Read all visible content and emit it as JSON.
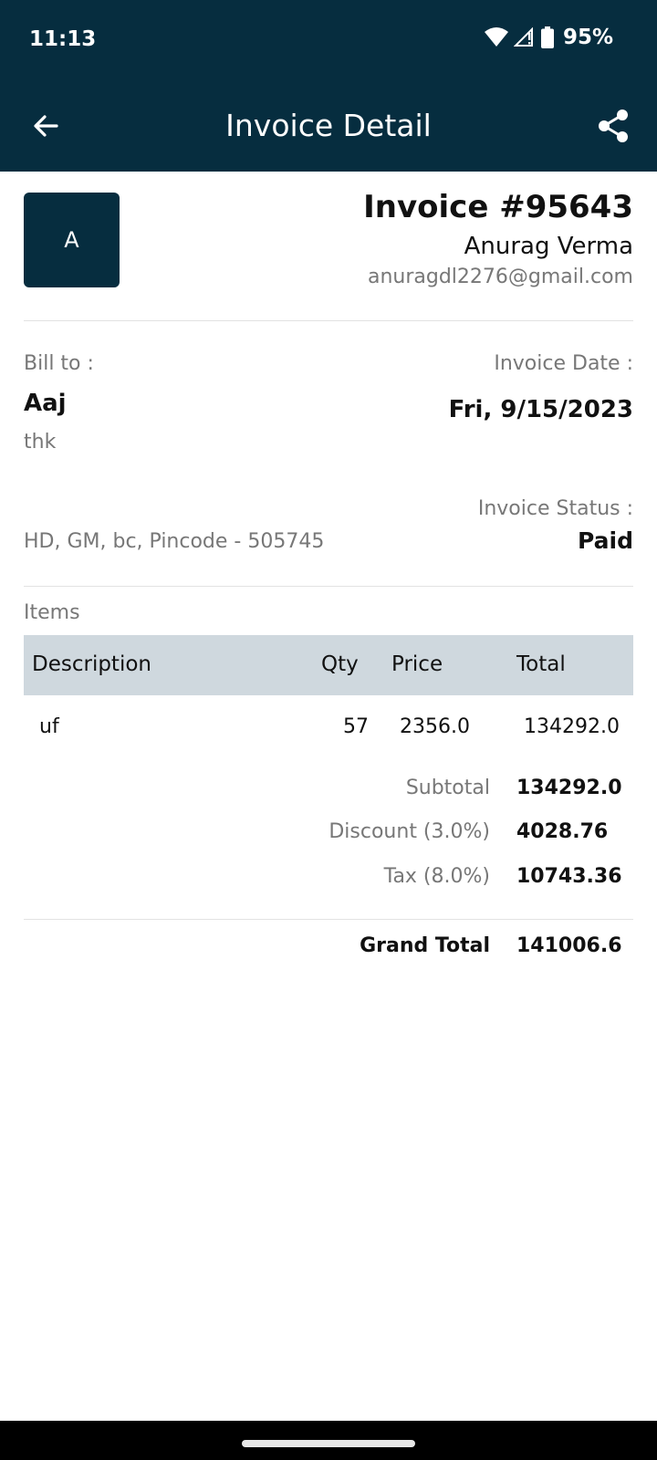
{
  "status_bar": {
    "time": "11:13",
    "battery": "95%",
    "icons": [
      "wifi-icon",
      "signal-icon",
      "battery-icon"
    ]
  },
  "app_bar": {
    "title": "Invoice Detail",
    "back_icon": "arrow-back-icon",
    "share_icon": "share-icon"
  },
  "header": {
    "avatar_initial": "A",
    "invoice_number": "Invoice #95643",
    "sender_name": "Anurag Verma",
    "sender_email": "anuragdl2276@gmail.com"
  },
  "bill_to": {
    "label": "Bill to :",
    "name": "Aaj",
    "subline": "thk",
    "address": "HD, GM, bc, Pincode - 505745"
  },
  "invoice_meta": {
    "date_label": "Invoice Date :",
    "date_value": "Fri, 9/15/2023",
    "status_label": "Invoice Status :",
    "status_value": "Paid"
  },
  "items": {
    "label": "Items",
    "columns": [
      "Description",
      "Qty",
      "Price",
      "Total"
    ],
    "rows": [
      {
        "description": "uf",
        "qty": "57",
        "price": "2356.0",
        "total": "134292.0"
      }
    ]
  },
  "summary": {
    "subtotal_label": "Subtotal",
    "subtotal_value": "134292.0",
    "discount_label": "Discount (3.0%)",
    "discount_value": "4028.76",
    "tax_label": "Tax (8.0%)",
    "tax_value": "10743.36",
    "grand_total_label": "Grand Total",
    "grand_total_value": "141006.6"
  },
  "colors": {
    "primary": "#062d3f",
    "table_header": "#cfd8de",
    "muted_text": "#777777"
  }
}
